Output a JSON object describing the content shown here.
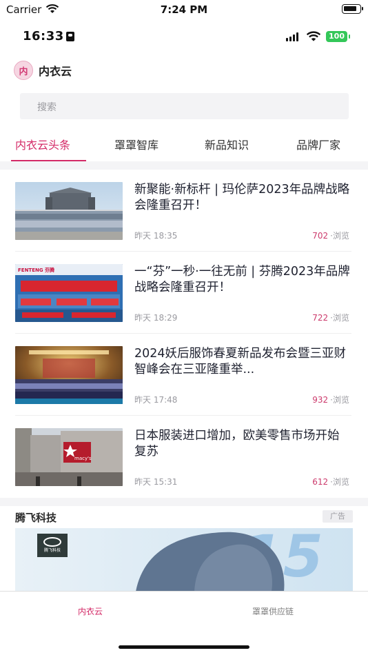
{
  "simulator_status": {
    "carrier": "Carrier",
    "time": "7:24 PM"
  },
  "app_status": {
    "time": "16:33",
    "battery": "100"
  },
  "app": {
    "logo_char": "内",
    "name": "内衣云"
  },
  "search": {
    "placeholder": "搜索"
  },
  "tabs": [
    {
      "label": "内衣云头条",
      "active": true
    },
    {
      "label": "罩罩智库",
      "active": false
    },
    {
      "label": "新品知识",
      "active": false
    },
    {
      "label": "品牌厂家",
      "active": false
    }
  ],
  "news": [
    {
      "title": "新聚能·新标杆 | 玛伦萨2023年品牌战略会隆重召开！",
      "date": "昨天  18:35",
      "views": "702",
      "views_suffix": "·浏览",
      "thumb_text": ""
    },
    {
      "title": "一“芬”一秒·一往无前 | 芬腾2023年品牌战略会隆重召开！",
      "date": "昨天  18:29",
      "views": "722",
      "views_suffix": "·浏览",
      "thumb_text": "FENTENG 芬腾"
    },
    {
      "title": "2024妖后服饰春夏新品发布会暨三亚财智峰会在三亚隆重举...",
      "date": "昨天  17:48",
      "views": "932",
      "views_suffix": "·浏览",
      "thumb_text": ""
    },
    {
      "title": "日本服装进口增加，欧美零售市场开始复苏",
      "date": "昨天  15:31",
      "views": "612",
      "views_suffix": "·浏览",
      "thumb_text": "macy's"
    }
  ],
  "ad": {
    "brand": "腾飞科技",
    "tag": "广告",
    "logo_text": "腾飞科技"
  },
  "tabbar": [
    {
      "label": "内衣云",
      "active": true
    },
    {
      "label": "罩罩供应链",
      "active": false
    }
  ],
  "colors": {
    "accent": "#d42a67",
    "views_number": "#cc3a6c",
    "battery": "#34c759"
  }
}
